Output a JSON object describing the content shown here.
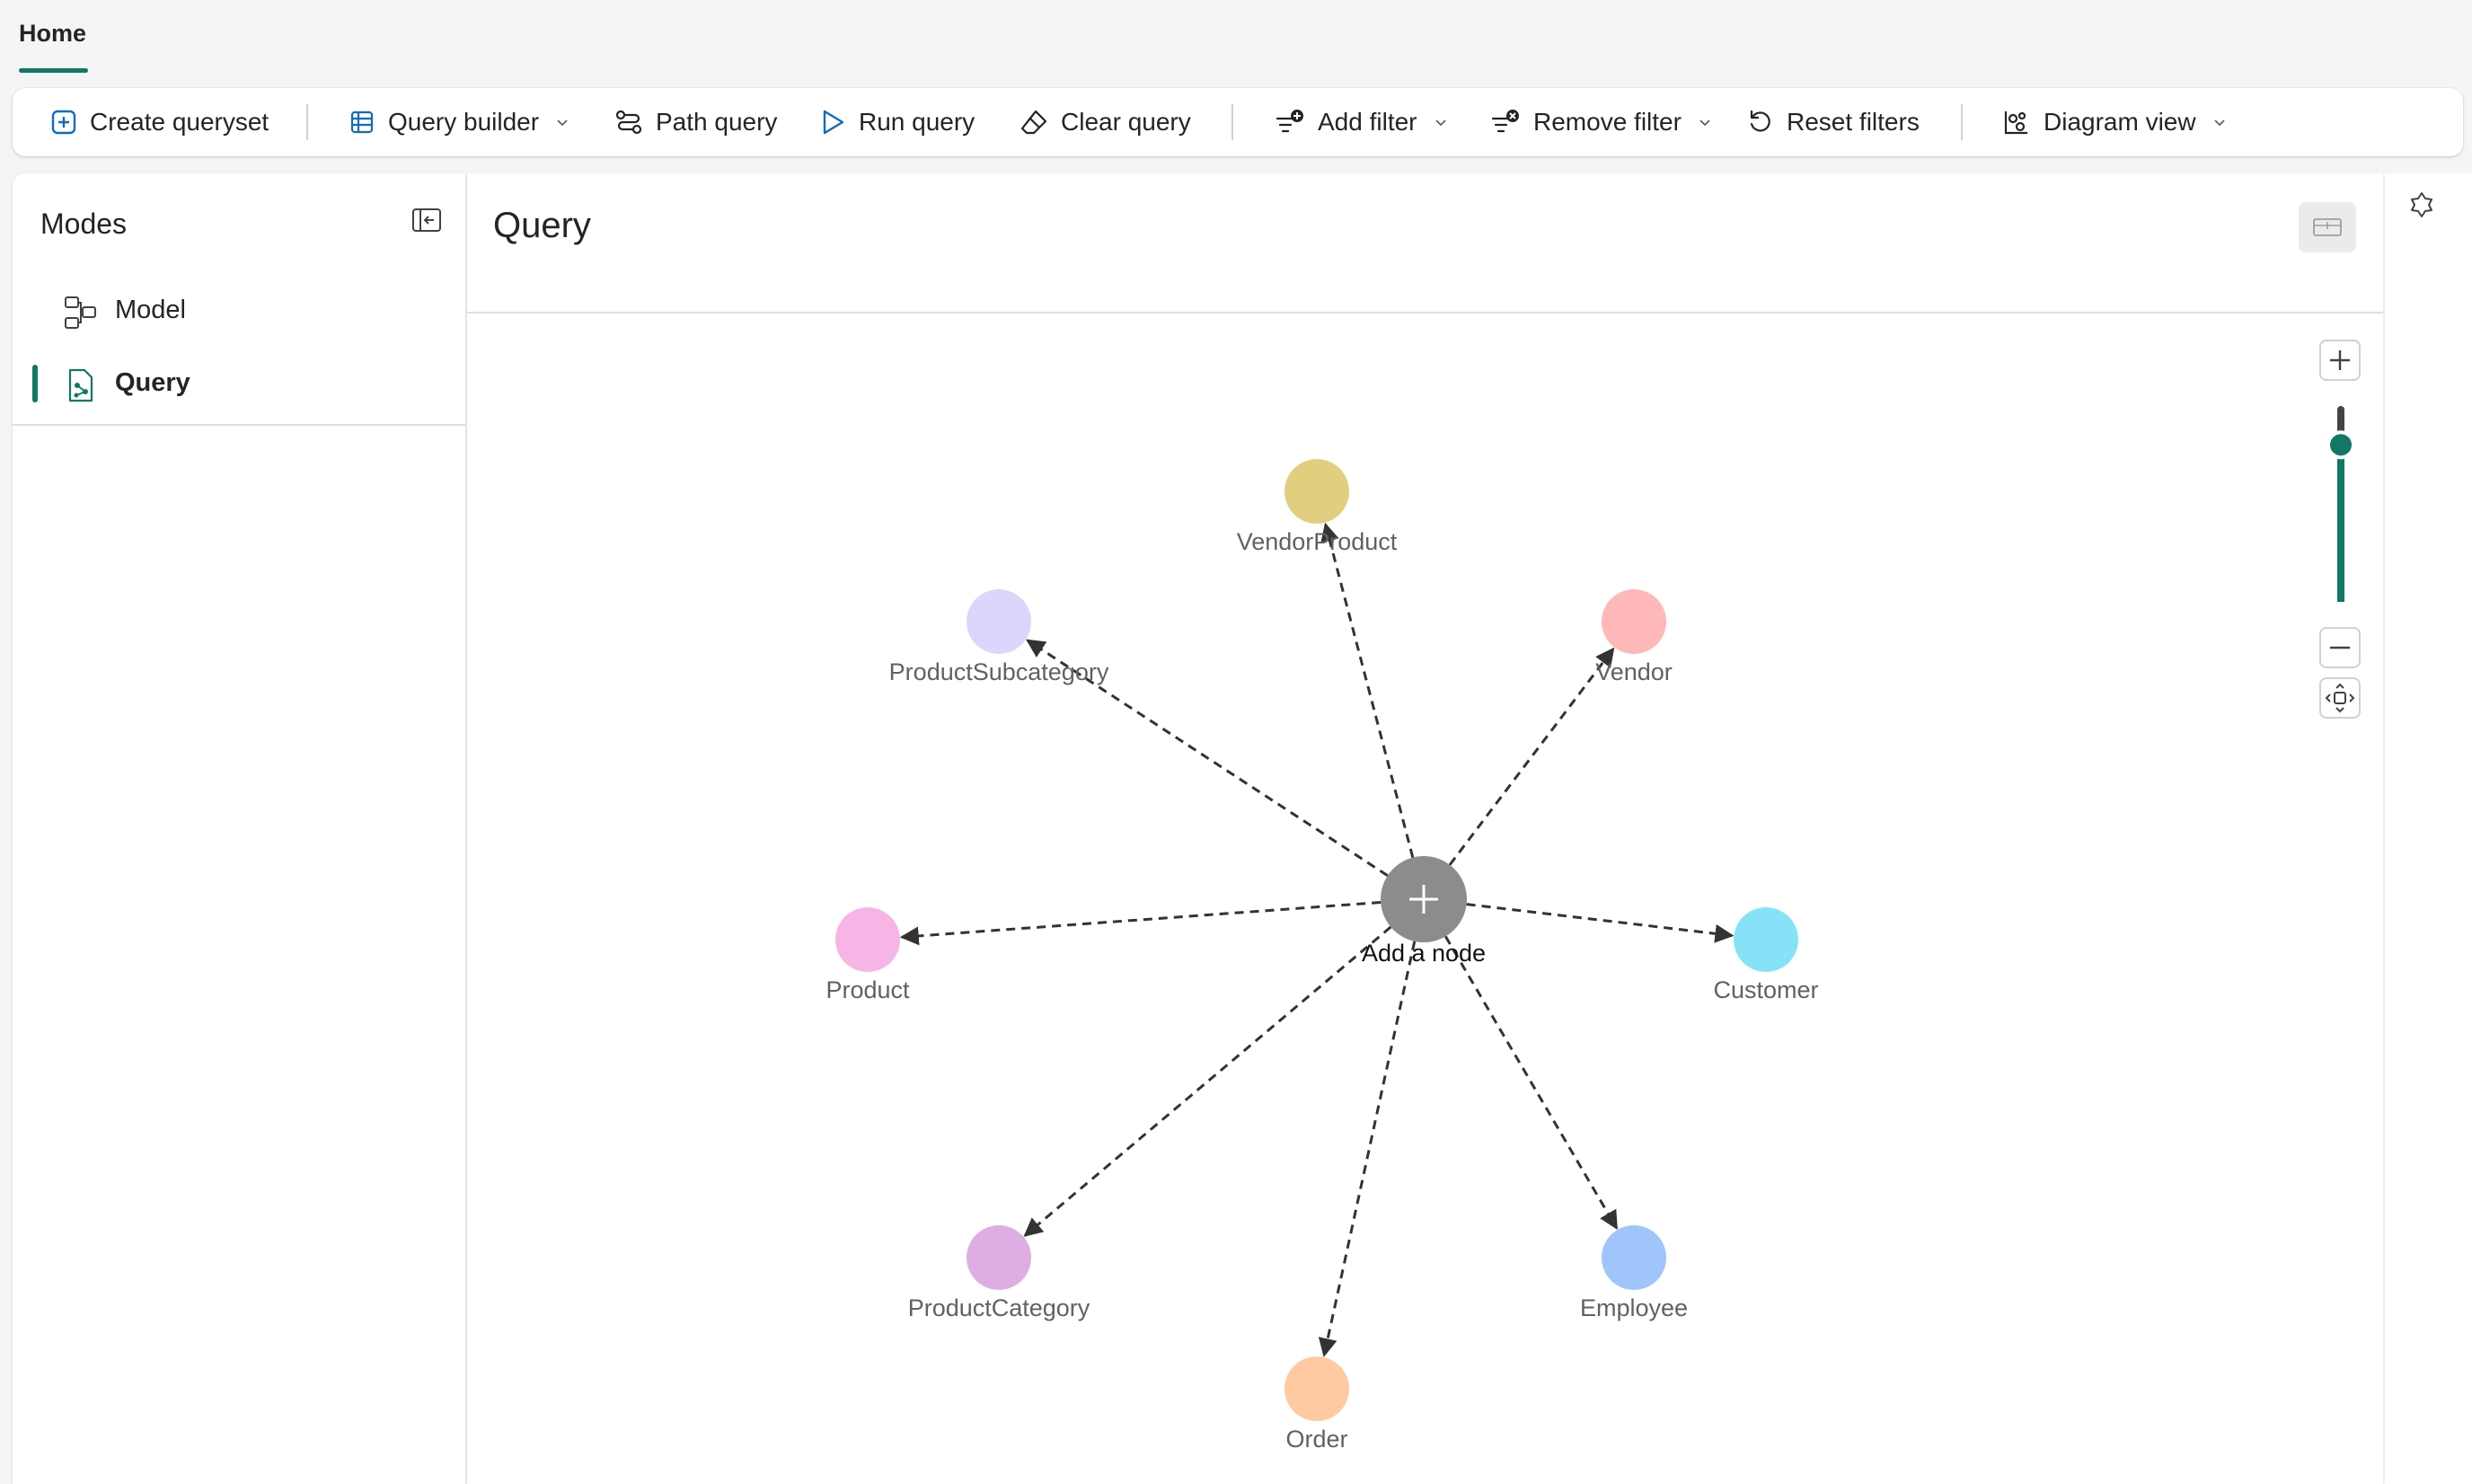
{
  "tabs": [
    {
      "label": "Home",
      "active": true
    }
  ],
  "ribbon": {
    "create_queryset": "Create queryset",
    "query_builder": "Query builder",
    "path_query": "Path query",
    "run_query": "Run query",
    "clear_query": "Clear query",
    "add_filter": "Add filter",
    "remove_filter": "Remove filter",
    "reset_filters": "Reset filters",
    "diagram_view": "Diagram view"
  },
  "modes": {
    "title": "Modes",
    "items": [
      {
        "label": "Model",
        "active": false
      },
      {
        "label": "Query",
        "active": true
      }
    ]
  },
  "main": {
    "title": "Query"
  },
  "graph": {
    "center": {
      "label": "Add a node",
      "color": "#8c8c8c"
    },
    "nodes": [
      {
        "label": "VendorProduct",
        "color": "#e0cf7e"
      },
      {
        "label": "ProductSubcategory",
        "color": "#ddd5fc"
      },
      {
        "label": "Vendor",
        "color": "#ffb8b8"
      },
      {
        "label": "Product",
        "color": "#f7b5e5"
      },
      {
        "label": "Customer",
        "color": "#86e3f7"
      },
      {
        "label": "ProductCategory",
        "color": "#deaee3"
      },
      {
        "label": "Employee",
        "color": "#9fc5fb"
      },
      {
        "label": "Order",
        "color": "#ffcaa2"
      }
    ]
  },
  "zoom": {
    "level": 0.85,
    "accent": "#117865"
  },
  "colors": {
    "accent": "#117865"
  }
}
